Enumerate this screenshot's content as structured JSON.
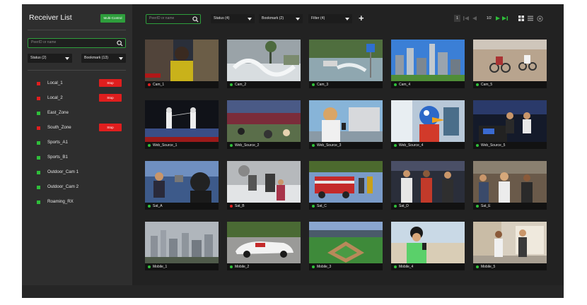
{
  "sidebar": {
    "title": "Receiver List",
    "multi_control_label": "Multi-Control",
    "search_placeholder": "PeerID or name",
    "status_filter": "Status (2)",
    "bookmark_filter": "Bookmark (13)",
    "receivers": [
      {
        "name": "Local_1",
        "status": "red",
        "stop_label": "Stop"
      },
      {
        "name": "Local_2",
        "status": "red",
        "stop_label": "Stop"
      },
      {
        "name": "East_Zone",
        "status": "green",
        "stop_label": ""
      },
      {
        "name": "South_Zone",
        "status": "red",
        "stop_label": "Stop"
      },
      {
        "name": "Sports_A1",
        "status": "green",
        "stop_label": ""
      },
      {
        "name": "Sports_B1",
        "status": "green",
        "stop_label": ""
      },
      {
        "name": "Outdoor_Cam 1",
        "status": "green",
        "stop_label": ""
      },
      {
        "name": "Outdoor_Cam 2",
        "status": "green",
        "stop_label": ""
      },
      {
        "name": "Roaming_RX",
        "status": "green",
        "stop_label": ""
      }
    ]
  },
  "toolbar": {
    "search_placeholder": "PeerID or name",
    "status_filter": "Status (4)",
    "bookmark_filter": "Bookmark (2)",
    "filter_label": "Filter (4)",
    "add_icon": "plus-icon",
    "current_page": "1",
    "page_text": "1/2",
    "icons": [
      "first-page-icon",
      "prev-page-icon",
      "next-page-icon",
      "last-page-icon",
      "grid-view-icon",
      "list-view-icon",
      "settings-icon"
    ]
  },
  "sources": [
    {
      "name": "Cam_1",
      "status": "red",
      "scene": "news"
    },
    {
      "name": "Cam_2",
      "status": "green",
      "scene": "storm"
    },
    {
      "name": "Cam_3",
      "status": "green",
      "scene": "flood"
    },
    {
      "name": "Cam_4",
      "status": "green",
      "scene": "city"
    },
    {
      "name": "Cam_5",
      "status": "green",
      "scene": "motocross"
    },
    {
      "name": "Web_Source_1",
      "status": "green",
      "scene": "fencing"
    },
    {
      "name": "Web_Source_2",
      "status": "green",
      "scene": "stadium"
    },
    {
      "name": "Web_Source_3",
      "status": "green",
      "scene": "reporter"
    },
    {
      "name": "Web_Source_4",
      "status": "green",
      "scene": "mascot"
    },
    {
      "name": "Web_Source_5",
      "status": "green",
      "scene": "studio"
    },
    {
      "name": "Sat_A",
      "status": "green",
      "scene": "interview"
    },
    {
      "name": "Sat_B",
      "status": "red",
      "scene": "snow"
    },
    {
      "name": "Sat_C",
      "status": "green",
      "scene": "firetruck"
    },
    {
      "name": "Sat_D",
      "status": "green",
      "scene": "athletes"
    },
    {
      "name": "Sat_E",
      "status": "green",
      "scene": "crowd"
    },
    {
      "name": "Mobile_1",
      "status": "green",
      "scene": "skyline"
    },
    {
      "name": "Mobile_2",
      "status": "green",
      "scene": "racecar"
    },
    {
      "name": "Mobile_3",
      "status": "green",
      "scene": "baseball"
    },
    {
      "name": "Mobile_4",
      "status": "green",
      "scene": "beach"
    },
    {
      "name": "Mobile_5",
      "status": "green",
      "scene": "street"
    }
  ],
  "colors": {
    "green": "#2fbf3a",
    "red": "#e01e1e",
    "accent": "#2e9e3c"
  }
}
